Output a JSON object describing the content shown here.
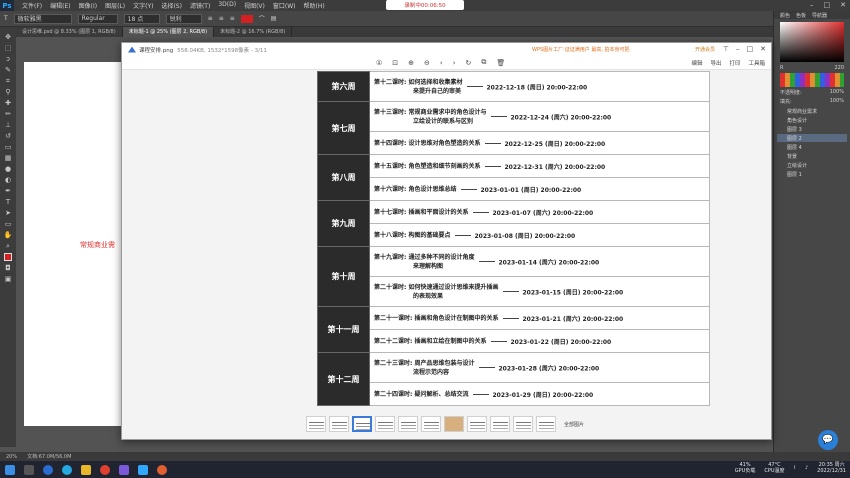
{
  "photoshop": {
    "logo": "Ps",
    "menu": [
      "文件(F)",
      "编辑(E)",
      "图像(I)",
      "图层(L)",
      "文字(Y)",
      "选择(S)",
      "滤镜(T)",
      "3D(D)",
      "视图(V)",
      "窗口(W)",
      "帮助(H)"
    ],
    "recording": "录制中00:06:50",
    "options": {
      "font": "微软雅黑",
      "style": "Regular",
      "size": "18 点",
      "aa": "锐利"
    },
    "doc_tabs": [
      "设计思维.psd @ 8.33% (图层 1, RGB/8)",
      "未标题-1 @ 25% (图层 2, RGB/8)",
      "未标题-2 @ 16.7% (RGB/8)"
    ],
    "canvas_text": "常规商业需",
    "status": {
      "zoom": "20%",
      "doc": "文档:67.0M/56.0M"
    },
    "panel_tabs": [
      "颜色",
      "色板",
      "导航器"
    ],
    "color_value": "220",
    "layer_opts": {
      "opacity_label": "不透明度:",
      "opacity": "100%",
      "fill_label": "填充:",
      "fill": "100%"
    },
    "layers": [
      "常规商业需求",
      "角色设计",
      "图层 3",
      "图层 2",
      "图层 4",
      "背景",
      "立绘设计",
      "图层 1"
    ]
  },
  "viewer": {
    "title": "课程安排.png",
    "dims": "558.04KB, 1532*1598像素 - 3/11",
    "promo": "WPS图片工厂·证证满用户 最高, 拍本身可把",
    "member": "开通会员",
    "toolbar_right": [
      "编辑",
      "导出",
      "打印",
      "工具箱"
    ],
    "all_images": "全部图片"
  },
  "schedule": [
    {
      "week": "第六周",
      "lessons": [
        {
          "topic": [
            "第十二课时: 如何选择和收集素材",
            "来提升自己的审美"
          ],
          "date": "2022-12-18 (周日) 20:00-22:00"
        }
      ]
    },
    {
      "week": "第七周",
      "lessons": [
        {
          "topic": [
            "第十三课时: 常规商业需求中的角色设计与",
            "立绘设计的联系与区别"
          ],
          "date": "2022-12-24 (周六) 20:00-22:00"
        },
        {
          "topic": [
            "第十四课时: 设计思维对角色塑造的关系"
          ],
          "date": "2022-12-25 (周日) 20:00-22:00"
        }
      ]
    },
    {
      "week": "第八周",
      "lessons": [
        {
          "topic": [
            "第十五课时: 角色塑造和细节刻画的关系"
          ],
          "date": "2022-12-31 (周六) 20:00-22:00"
        },
        {
          "topic": [
            "第十六课时: 角色设计思维总结"
          ],
          "date": "2023-01-01 (周日) 20:00-22:00"
        }
      ]
    },
    {
      "week": "第九周",
      "lessons": [
        {
          "topic": [
            "第十七课时: 插画和平面设计的关系"
          ],
          "date": "2023-01-07 (周六) 20:00-22:00"
        },
        {
          "topic": [
            "第十八课时: 构图的基础要点"
          ],
          "date": "2023-01-08 (周日) 20:00-22:00"
        }
      ]
    },
    {
      "week": "第十周",
      "lessons": [
        {
          "topic": [
            "第十九课时: 通过多种不同的设计角度",
            "来理解构图"
          ],
          "date": "2023-01-14 (周六) 20:00-22:00"
        },
        {
          "topic": [
            "第二十课时: 如何快速通过设计思维来提升插画",
            "的表现效果"
          ],
          "date": "2023-01-15 (周日) 20:00-22:00"
        }
      ]
    },
    {
      "week": "第十一周",
      "lessons": [
        {
          "topic": [
            "第二十一课时: 插画和角色设计在制图中的关系"
          ],
          "date": "2023-01-21 (周六) 20:00-22:00"
        },
        {
          "topic": [
            "第二十二课时: 插画和立绘在制图中的关系"
          ],
          "date": "2023-01-22 (周日) 20:00-22:00"
        }
      ]
    },
    {
      "week": "第十二周",
      "lessons": [
        {
          "topic": [
            "第二十三课时: 周产品思维包装与设计",
            "流程示范内容"
          ],
          "date": "2023-01-28 (周六) 20:00-22:00"
        },
        {
          "topic": [
            "第二十四课时: 疑问解析、总结交流"
          ],
          "date": "2023-01-29 (周日) 20:00-22:00"
        }
      ]
    }
  ],
  "tray": {
    "gpu": "41%",
    "gpu_label": "GPU负载",
    "cpu": "47°C",
    "cpu_label": "CPU温度",
    "time": "20:35 周六",
    "date": "2022/12/31"
  }
}
